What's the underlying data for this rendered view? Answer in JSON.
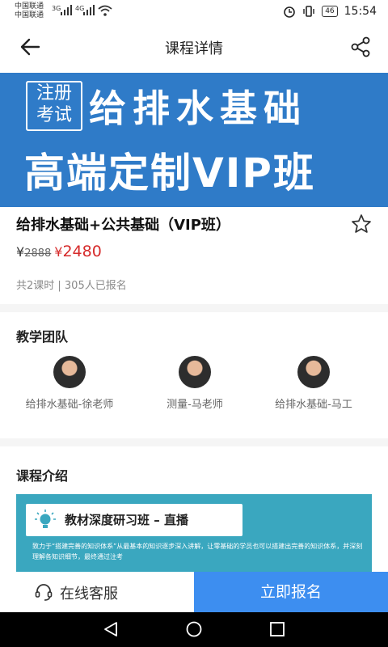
{
  "status_bar": {
    "carrier_1": "中国联通",
    "carrier_2": "中国联通",
    "network_1": "3G",
    "network_2": "4G",
    "battery": "46",
    "time": "15:54"
  },
  "nav": {
    "title": "课程详情",
    "back_icon": "back-arrow-icon",
    "share_icon": "share-icon"
  },
  "banner": {
    "badge_line1": "注册",
    "badge_line2": "考试",
    "line1": "给排水基础",
    "line2": "高端定制VIP班",
    "background": "#2f7bc8"
  },
  "course": {
    "title": "给排水基础+公共基础（VIP班）",
    "currency": "¥",
    "original_price": "2888",
    "price": "2480",
    "meta": "共2课时 | 305人已报名",
    "price_color": "#d62b2b"
  },
  "team": {
    "title": "教学团队",
    "teachers": [
      {
        "name": "给排水基础-徐老师"
      },
      {
        "name": "测量-马老师"
      },
      {
        "name": "给排水基础-马工"
      }
    ]
  },
  "intro": {
    "title": "课程介绍",
    "card_title": "教材深度研习班 – 直播",
    "description": "致力于“搭建完善的知识体系”从最基本的知识逐步深入讲解，让零基础的学员也可以搭建出完善的知识体系，并深刻理解各知识细节，最终通过注考",
    "background": "#3aa7bf"
  },
  "bottom_bar": {
    "customer_service": "在线客服",
    "enroll": "立即报名",
    "enroll_color": "#3d8ef0"
  }
}
